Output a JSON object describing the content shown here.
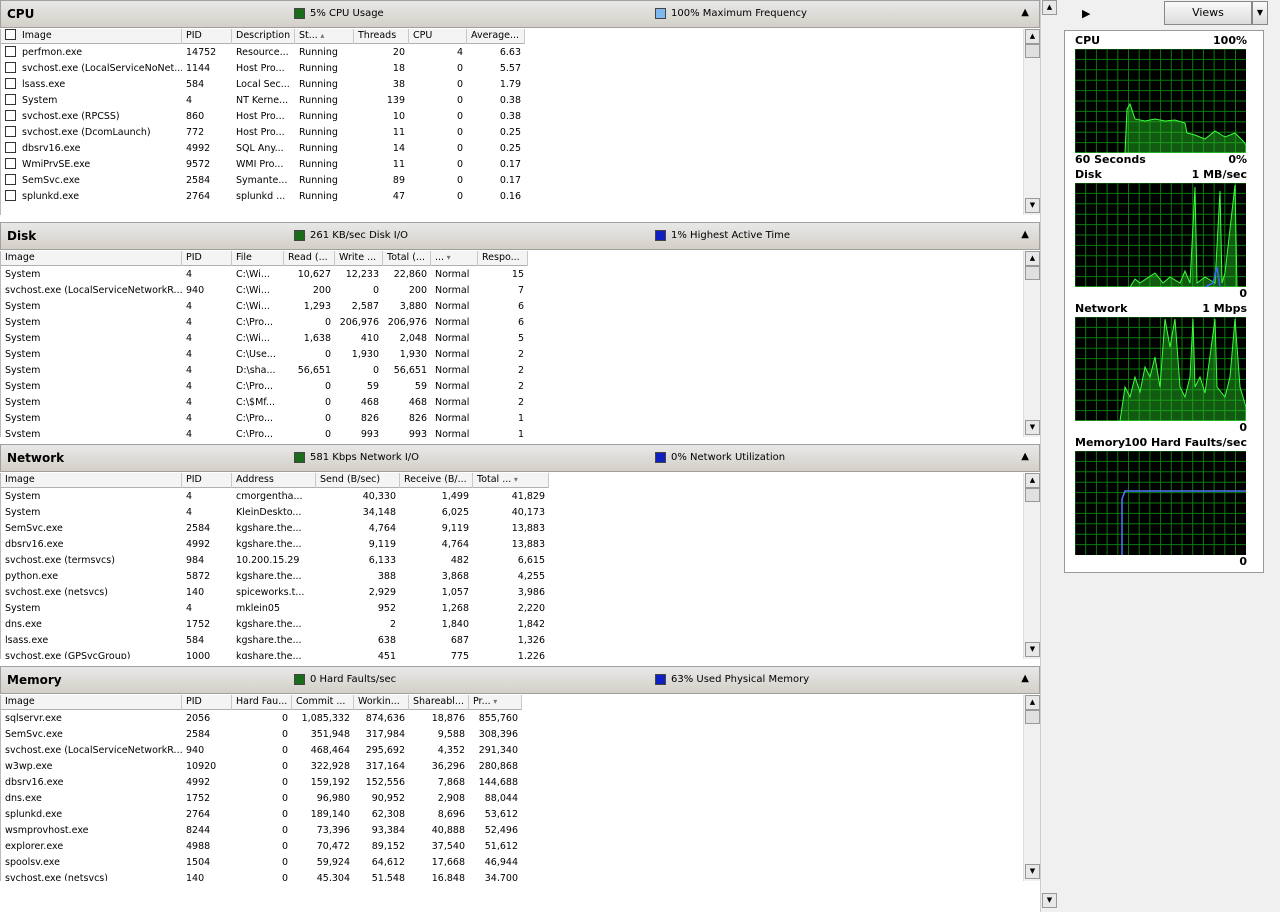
{
  "cpu": {
    "title": "CPU",
    "stat1": "5% CPU Usage",
    "stat1_color": "#1a6b1a",
    "stat2": "100% Maximum Frequency",
    "stat2_color": "#7fb8f0",
    "columns": [
      "Image",
      "PID",
      "Description",
      "St...",
      "Threads",
      "CPU",
      "Average..."
    ],
    "rows": [
      [
        "perfmon.exe",
        "14752",
        "Resource...",
        "Running",
        "20",
        "4",
        "6.63"
      ],
      [
        "svchost.exe (LocalServiceNoNet...",
        "1144",
        "Host Pro...",
        "Running",
        "18",
        "0",
        "5.57"
      ],
      [
        "lsass.exe",
        "584",
        "Local Sec...",
        "Running",
        "38",
        "0",
        "1.79"
      ],
      [
        "System",
        "4",
        "NT Kerne...",
        "Running",
        "139",
        "0",
        "0.38"
      ],
      [
        "svchost.exe (RPCSS)",
        "860",
        "Host Pro...",
        "Running",
        "10",
        "0",
        "0.38"
      ],
      [
        "svchost.exe (DcomLaunch)",
        "772",
        "Host Pro...",
        "Running",
        "11",
        "0",
        "0.25"
      ],
      [
        "dbsrv16.exe",
        "4992",
        "SQL Any...",
        "Running",
        "14",
        "0",
        "0.25"
      ],
      [
        "WmiPrvSE.exe",
        "9572",
        "WMI Pro...",
        "Running",
        "11",
        "0",
        "0.17"
      ],
      [
        "SemSvc.exe",
        "2584",
        "Symante...",
        "Running",
        "89",
        "0",
        "0.17"
      ],
      [
        "splunkd.exe",
        "2764",
        "splunkd ...",
        "Running",
        "47",
        "0",
        "0.16"
      ]
    ]
  },
  "disk": {
    "title": "Disk",
    "stat1": "261 KB/sec Disk I/O",
    "stat1_color": "#1a6b1a",
    "stat2": "1% Highest Active Time",
    "stat2_color": "#1020c0",
    "columns": [
      "Image",
      "PID",
      "File",
      "Read (...",
      "Write ...",
      "Total (...",
      "...",
      "Respo..."
    ],
    "rows": [
      [
        "System",
        "4",
        "C:\\Wi...",
        "10,627",
        "12,233",
        "22,860",
        "Normal",
        "15"
      ],
      [
        "svchost.exe (LocalServiceNetworkR...",
        "940",
        "C:\\Wi...",
        "200",
        "0",
        "200",
        "Normal",
        "7"
      ],
      [
        "System",
        "4",
        "C:\\Wi...",
        "1,293",
        "2,587",
        "3,880",
        "Normal",
        "6"
      ],
      [
        "System",
        "4",
        "C:\\Pro...",
        "0",
        "206,976",
        "206,976",
        "Normal",
        "6"
      ],
      [
        "System",
        "4",
        "C:\\Wi...",
        "1,638",
        "410",
        "2,048",
        "Normal",
        "5"
      ],
      [
        "System",
        "4",
        "C:\\Use...",
        "0",
        "1,930",
        "1,930",
        "Normal",
        "2"
      ],
      [
        "System",
        "4",
        "D:\\sha...",
        "56,651",
        "0",
        "56,651",
        "Normal",
        "2"
      ],
      [
        "System",
        "4",
        "C:\\Pro...",
        "0",
        "59",
        "59",
        "Normal",
        "2"
      ],
      [
        "System",
        "4",
        "C:\\$Mf...",
        "0",
        "468",
        "468",
        "Normal",
        "2"
      ],
      [
        "System",
        "4",
        "C:\\Pro...",
        "0",
        "826",
        "826",
        "Normal",
        "1"
      ],
      [
        "System",
        "4",
        "C:\\Pro...",
        "0",
        "993",
        "993",
        "Normal",
        "1"
      ]
    ]
  },
  "network": {
    "title": "Network",
    "stat1": "581 Kbps Network I/O",
    "stat1_color": "#1a6b1a",
    "stat2": "0% Network Utilization",
    "stat2_color": "#1020c0",
    "columns": [
      "Image",
      "PID",
      "Address",
      "Send (B/sec)",
      "Receive (B/...",
      "Total ..."
    ],
    "rows": [
      [
        "System",
        "4",
        "cmorgentha...",
        "40,330",
        "1,499",
        "41,829"
      ],
      [
        "System",
        "4",
        "KleinDeskto...",
        "34,148",
        "6,025",
        "40,173"
      ],
      [
        "SemSvc.exe",
        "2584",
        "kgshare.the...",
        "4,764",
        "9,119",
        "13,883"
      ],
      [
        "dbsrv16.exe",
        "4992",
        "kgshare.the...",
        "9,119",
        "4,764",
        "13,883"
      ],
      [
        "svchost.exe (termsvcs)",
        "984",
        "10.200.15.29",
        "6,133",
        "482",
        "6,615"
      ],
      [
        "python.exe",
        "5872",
        "kgshare.the...",
        "388",
        "3,868",
        "4,255"
      ],
      [
        "svchost.exe (netsvcs)",
        "140",
        "spiceworks.t...",
        "2,929",
        "1,057",
        "3,986"
      ],
      [
        "System",
        "4",
        "mklein05",
        "952",
        "1,268",
        "2,220"
      ],
      [
        "dns.exe",
        "1752",
        "kgshare.the...",
        "2",
        "1,840",
        "1,842"
      ],
      [
        "lsass.exe",
        "584",
        "kgshare.the...",
        "638",
        "687",
        "1,326"
      ],
      [
        "svchost.exe (GPSvcGroup)",
        "1000",
        "kgshare.the...",
        "451",
        "775",
        "1,226"
      ]
    ]
  },
  "memory": {
    "title": "Memory",
    "stat1": "0 Hard Faults/sec",
    "stat1_color": "#1a6b1a",
    "stat2": "63% Used Physical Memory",
    "stat2_color": "#1020c0",
    "columns": [
      "Image",
      "PID",
      "Hard Fau...",
      "Commit ...",
      "Workin...",
      "Shareabl...",
      "Pr..."
    ],
    "rows": [
      [
        "sqlservr.exe",
        "2056",
        "0",
        "1,085,332",
        "874,636",
        "18,876",
        "855,760"
      ],
      [
        "SemSvc.exe",
        "2584",
        "0",
        "351,948",
        "317,984",
        "9,588",
        "308,396"
      ],
      [
        "svchost.exe (LocalServiceNetworkR...",
        "940",
        "0",
        "468,464",
        "295,692",
        "4,352",
        "291,340"
      ],
      [
        "w3wp.exe",
        "10920",
        "0",
        "322,928",
        "317,164",
        "36,296",
        "280,868"
      ],
      [
        "dbsrv16.exe",
        "4992",
        "0",
        "159,192",
        "152,556",
        "7,868",
        "144,688"
      ],
      [
        "dns.exe",
        "1752",
        "0",
        "96,980",
        "90,952",
        "2,908",
        "88,044"
      ],
      [
        "splunkd.exe",
        "2764",
        "0",
        "189,140",
        "62,308",
        "8,696",
        "53,612"
      ],
      [
        "wsmprovhost.exe",
        "8244",
        "0",
        "73,396",
        "93,384",
        "40,888",
        "52,496"
      ],
      [
        "explorer.exe",
        "4988",
        "0",
        "70,472",
        "89,152",
        "37,540",
        "51,612"
      ],
      [
        "spoolsv.exe",
        "1504",
        "0",
        "59,924",
        "64,612",
        "17,668",
        "46,944"
      ],
      [
        "svchost.exe (netsvcs)",
        "140",
        "0",
        "45,304",
        "51,548",
        "16,848",
        "34,700"
      ]
    ]
  },
  "sidepanel": {
    "views_label": "Views",
    "cpu_label": "CPU",
    "cpu_max": "100%",
    "cpu_window": "60 Seconds",
    "cpu_min": "0%",
    "disk_label": "Disk",
    "disk_max": "1 MB/sec",
    "disk_min": "0",
    "network_label": "Network",
    "network_max": "1 Mbps",
    "network_min": "0",
    "memory_label": "Memory",
    "memory_max": "100 Hard Faults/sec",
    "memory_min": "0"
  }
}
